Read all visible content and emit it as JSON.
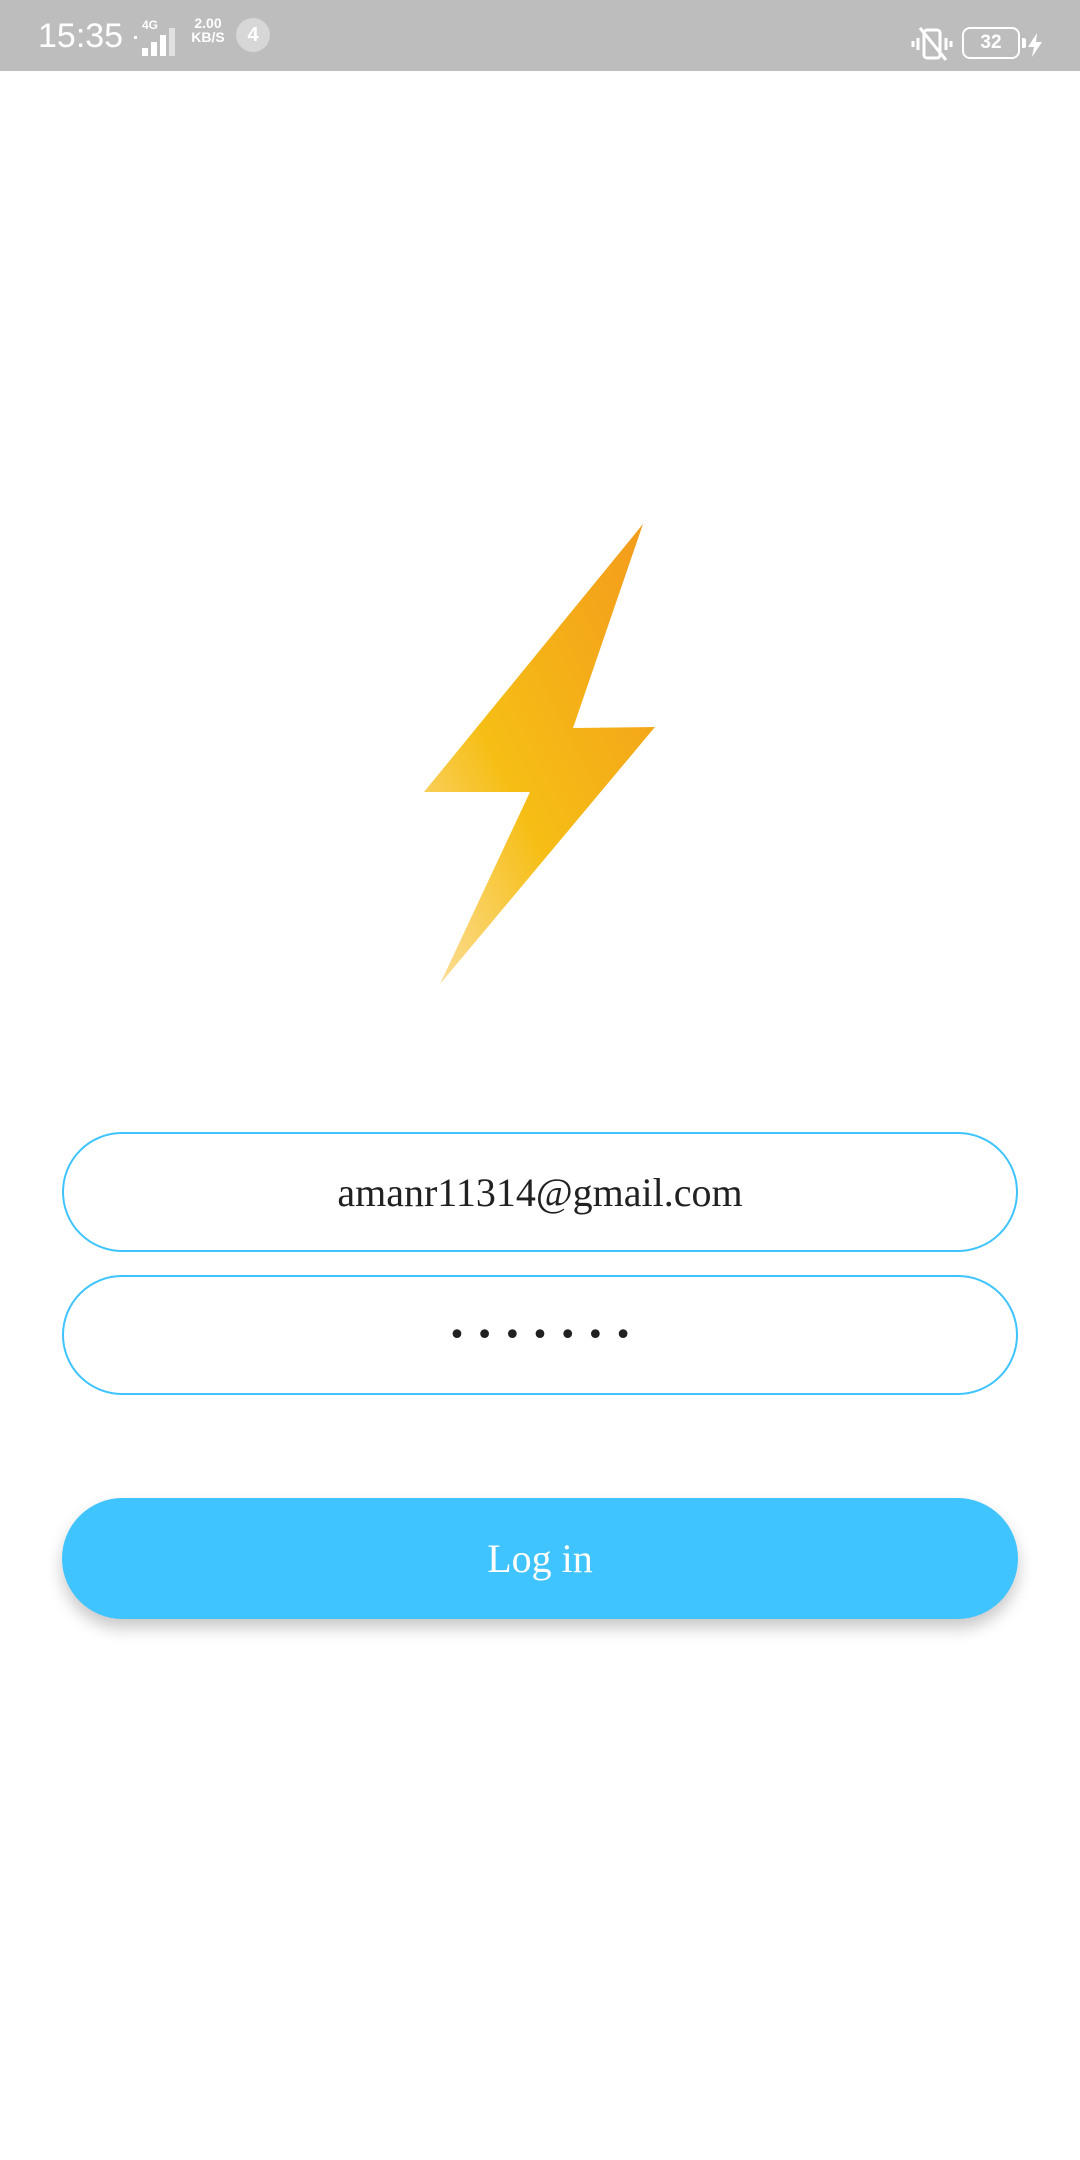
{
  "status_bar": {
    "time": "15:35",
    "network": "4G",
    "speed_value": "2.00",
    "speed_unit": "KB/S",
    "notification_count": "4",
    "battery_level": "32",
    "icons": [
      "signal-icon",
      "vibrate-off-icon",
      "battery-icon",
      "charging-icon"
    ]
  },
  "logo": {
    "icon": "lightning-bolt-icon",
    "colors": [
      "#f5a21d",
      "#f6c215",
      "#fbd57a"
    ]
  },
  "login_form": {
    "email_value": "amanr11314@gmail.com",
    "password_mask": "•••••••",
    "login_label": "Log in"
  },
  "theme": {
    "accent": "#40c4ff",
    "text": "#212121",
    "background": "#ffffff",
    "status_bar_bg": "#bdbdbd"
  }
}
